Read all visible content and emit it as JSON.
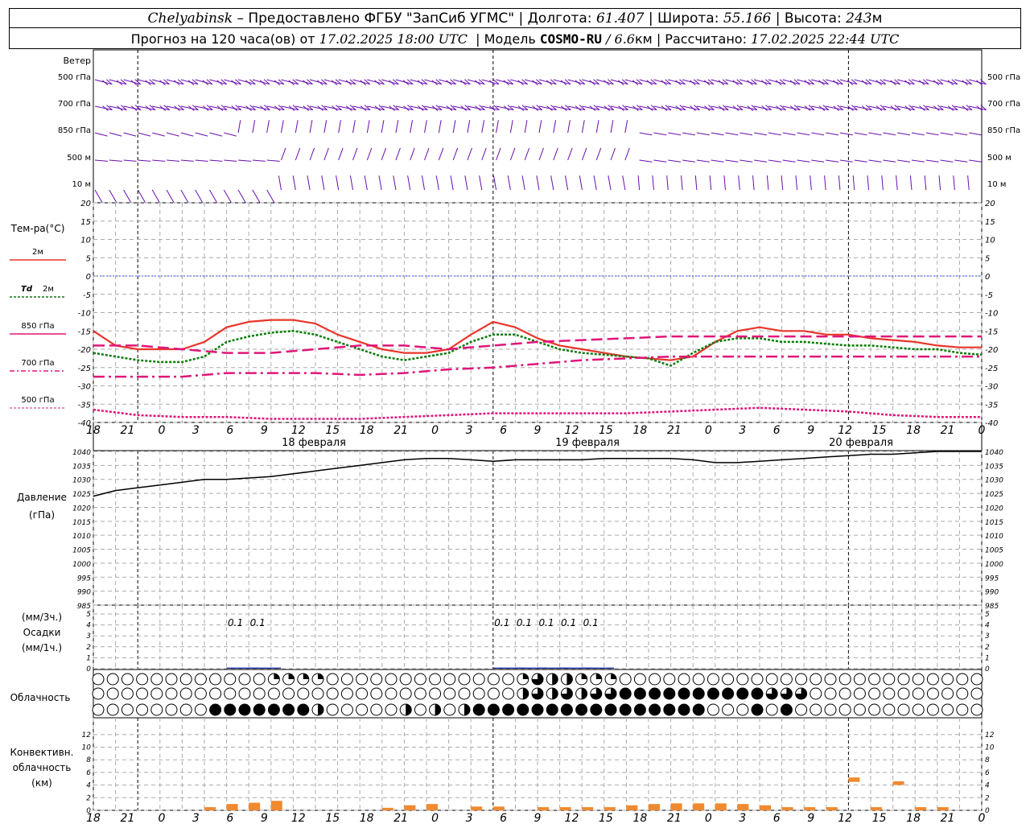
{
  "header": {
    "station": "Chelyabinsk",
    "dash": "–",
    "provider": "Предоставлено ФГБУ \"ЗапСиб УГМС\"",
    "lon_label": "Долгота:",
    "lon_value": "61.407",
    "lat_label": "Широта:",
    "lat_value": "55.166",
    "alt_label": "Высота:",
    "alt_value": "243",
    "alt_unit": "м",
    "forecast_prefix": "Прогноз на 120 часа(ов) от",
    "forecast_time": "17.02.2025 18:00 UTC",
    "model_label": "Модель",
    "model_name": "COSMO-RU",
    "model_res": "/ 6.6",
    "model_res_unit": "км",
    "calc_label": "Рассчитано:",
    "calc_time": "17.02.2025 22:44 UTC"
  },
  "time_axis": {
    "tick_labels": [
      "18",
      "21",
      "0",
      "3",
      "6",
      "9",
      "12",
      "15",
      "18",
      "21",
      "0",
      "3",
      "6",
      "9",
      "12",
      "15",
      "18",
      "21",
      "0",
      "3",
      "6",
      "9",
      "12",
      "15",
      "18",
      "21",
      "0"
    ],
    "day_labels": [
      "18 февраля",
      "19 февраля",
      "20 февраля"
    ]
  },
  "wind": {
    "title": "Ветер",
    "levels": [
      "500 гПа",
      "700 гПа",
      "850 гПа",
      "500 м",
      "10  м"
    ],
    "color": "#6a0dad"
  },
  "temperature": {
    "title": "Тем-ра(°C)",
    "legend_t2m": "2м",
    "legend_td_sym": "Td",
    "legend_td": "2м",
    "legend_850": "850 гПа",
    "legend_700": "700 гПа",
    "legend_500": "500 гПа",
    "ticks": [
      "20",
      "15",
      "10",
      "5",
      "0",
      "-5",
      "-10",
      "-15",
      "-20",
      "-25",
      "-30",
      "-35",
      "-40"
    ],
    "colors": {
      "t2m": "#e8352a",
      "td": "#0a7a0a",
      "t850": "#e0157a",
      "zero": "#3050d0"
    }
  },
  "pressure": {
    "title": "Давление",
    "unit": "(гПа)",
    "ticks": [
      "1040",
      "1035",
      "1030",
      "1025",
      "1020",
      "1015",
      "1010",
      "1005",
      "1000",
      "995",
      "990",
      "985"
    ]
  },
  "precip": {
    "unit_3h": "(мм/3ч.)",
    "title": "Осадки",
    "unit_1h": "(мм/1ч.)",
    "ticks": [
      "5",
      "4",
      "3",
      "2",
      "1",
      "0"
    ],
    "labels": [
      {
        "hour": 18,
        "text": "0.1"
      },
      {
        "hour": 21,
        "text": "0.1"
      },
      {
        "hour": 54,
        "text": "0.1"
      },
      {
        "hour": 57,
        "text": "0.1"
      },
      {
        "hour": 60,
        "text": "0.1"
      },
      {
        "hour": 63,
        "text": "0.1"
      },
      {
        "hour": 66,
        "text": "0.1"
      }
    ]
  },
  "cloudiness": {
    "title": "Облачность"
  },
  "convective": {
    "title1": "Конвективн.",
    "title2": "облачность",
    "unit": "(км)",
    "ticks": [
      "12",
      "10",
      "8",
      "6",
      "4",
      "2",
      "0"
    ],
    "color": "#f08a30"
  },
  "chart_data": [
    {
      "type": "line",
      "title": "Тем-ра(°C)",
      "x_unit": "hours from 17.02.2025 18:00 UTC",
      "ylim": [
        -40,
        20
      ],
      "series": [
        {
          "name": "2м",
          "x": [
            0,
            3,
            6,
            9,
            12,
            15,
            18,
            21,
            24,
            27,
            30,
            33,
            36,
            39,
            42,
            45,
            48,
            51,
            54,
            57,
            60,
            63,
            66,
            69,
            72,
            75,
            78,
            81,
            84,
            87,
            90,
            93,
            96,
            99,
            102,
            105,
            108,
            111,
            114,
            117,
            120
          ],
          "values": [
            -15,
            -19,
            -20,
            -20,
            -20,
            -18,
            -14,
            -12.5,
            -12,
            -12,
            -13,
            -16,
            -18,
            -20,
            -21,
            -21,
            -20,
            -16,
            -12.5,
            -14,
            -17,
            -19,
            -20,
            -21,
            -22,
            -22.5,
            -23,
            -22,
            -18,
            -15,
            -14,
            -15,
            -15,
            -16,
            -16,
            -17,
            -17.5,
            -18,
            -19,
            -19.5,
            -19.5
          ]
        },
        {
          "name": "Td 2м",
          "x": [
            0,
            3,
            6,
            9,
            12,
            15,
            18,
            21,
            24,
            27,
            30,
            33,
            36,
            39,
            42,
            45,
            48,
            51,
            54,
            57,
            60,
            63,
            66,
            69,
            72,
            75,
            78,
            81,
            84,
            87,
            90,
            93,
            96,
            99,
            102,
            105,
            108,
            111,
            114,
            117,
            120
          ],
          "values": [
            -21,
            -22,
            -23,
            -23.5,
            -23.5,
            -22,
            -18,
            -16.5,
            -15.5,
            -15,
            -16,
            -18,
            -20,
            -22,
            -23,
            -22,
            -21,
            -18,
            -16,
            -16,
            -18,
            -20,
            -21,
            -21.5,
            -22,
            -22.5,
            -24.5,
            -21,
            -18,
            -17,
            -17,
            -18,
            -18,
            -18.5,
            -19,
            -19,
            -19.5,
            -20,
            -20,
            -21,
            -21.5
          ]
        },
        {
          "name": "850 гПа",
          "x": [
            0,
            6,
            12,
            18,
            24,
            30,
            36,
            42,
            48,
            54,
            60,
            66,
            72,
            78,
            84,
            90,
            96,
            102,
            108,
            114,
            120
          ],
          "values": [
            -19,
            -19,
            -20,
            -21,
            -21,
            -20,
            -19,
            -19,
            -20,
            -19,
            -18,
            -17.5,
            -17,
            -16.5,
            -16.5,
            -16.5,
            -16.5,
            -16.5,
            -16.5,
            -16.5,
            -16.5
          ]
        },
        {
          "name": "700 гПа",
          "x": [
            0,
            6,
            12,
            18,
            24,
            30,
            36,
            42,
            48,
            54,
            60,
            66,
            72,
            78,
            84,
            90,
            96,
            102,
            108,
            114,
            120
          ],
          "values": [
            -27.5,
            -27.5,
            -27.5,
            -26.5,
            -26.5,
            -26.5,
            -27,
            -26.5,
            -25.5,
            -25,
            -24,
            -23,
            -22.5,
            -22,
            -22,
            -22,
            -22,
            -22,
            -22,
            -22,
            -22
          ]
        },
        {
          "name": "500 гПа",
          "x": [
            0,
            6,
            12,
            18,
            24,
            30,
            36,
            42,
            48,
            54,
            60,
            66,
            72,
            78,
            84,
            90,
            96,
            102,
            108,
            114,
            120
          ],
          "values": [
            -36.5,
            -38,
            -38.5,
            -38.5,
            -39,
            -39,
            -39,
            -38.5,
            -38,
            -37.5,
            -37.5,
            -37.5,
            -37.5,
            -37,
            -36.5,
            -36,
            -36.5,
            -37,
            -38,
            -38.5,
            -38.5
          ]
        }
      ]
    },
    {
      "type": "line",
      "title": "Давление",
      "x_unit": "hours from 17.02.2025 18:00 UTC",
      "ylim": [
        985,
        1040
      ],
      "series": [
        {
          "name": "Давление",
          "x": [
            0,
            3,
            6,
            9,
            12,
            15,
            18,
            21,
            24,
            27,
            30,
            33,
            36,
            39,
            42,
            45,
            48,
            51,
            54,
            57,
            60,
            63,
            66,
            69,
            72,
            75,
            78,
            81,
            84,
            87,
            90,
            93,
            96,
            99,
            102,
            105,
            108,
            111,
            114,
            117,
            120
          ],
          "values": [
            1024,
            1026,
            1027,
            1028,
            1029,
            1030,
            1030,
            1030.5,
            1031,
            1032,
            1033,
            1034,
            1035,
            1036,
            1037,
            1037.5,
            1037.5,
            1037,
            1036.5,
            1037,
            1037,
            1037,
            1037,
            1037.5,
            1037.5,
            1037.5,
            1037.5,
            1037,
            1036,
            1036,
            1036.5,
            1037,
            1037.5,
            1038,
            1038.5,
            1039,
            1039,
            1039.5,
            1040,
            1040,
            1040
          ]
        }
      ]
    },
    {
      "type": "bar",
      "title": "Осадки",
      "x_unit": "hours from 17.02.2025 18:00 UTC",
      "ylim": [
        0,
        5
      ],
      "x": [
        18,
        21,
        54,
        57,
        60,
        63,
        66
      ],
      "values": [
        0.1,
        0.1,
        0.1,
        0.1,
        0.1,
        0.1,
        0.1
      ]
    },
    {
      "type": "bar",
      "title": "Конвективн. облачность",
      "x_unit": "hours from 17.02.2025 18:00 UTC",
      "ylim": [
        0,
        13
      ],
      "series": [
        {
          "x": [
            15,
            18,
            21,
            24,
            39,
            42,
            45,
            51,
            54,
            60,
            63,
            66,
            69,
            72,
            75,
            78,
            81,
            84,
            87,
            90,
            93,
            96,
            99,
            102,
            105,
            108,
            111,
            114
          ],
          "bottom": [
            0,
            0,
            0,
            0,
            0,
            0,
            0,
            0,
            0,
            0,
            0,
            0,
            0,
            0,
            0,
            0,
            0,
            0,
            0,
            0,
            0,
            0,
            0,
            4.5,
            0,
            4,
            0,
            0
          ],
          "top": [
            0.5,
            1,
            1.2,
            1.5,
            0.4,
            0.8,
            1,
            0.6,
            0.6,
            0.5,
            0.5,
            0.5,
            0.5,
            0.8,
            1,
            1.1,
            1.1,
            1.1,
            1,
            0.8,
            0.5,
            0.5,
            0.5,
            5.2,
            0.5,
            4.6,
            0.5,
            0.5
          ]
        }
      ]
    },
    {
      "type": "table",
      "title": "Облачность",
      "rows": [
        {
          "level": "high",
          "x": [
            24,
            26,
            28,
            30
          ],
          "fraction": [
            0.25,
            0.25,
            0.25,
            0.25
          ]
        },
        {
          "level": "high2",
          "x": [
            58,
            59,
            60,
            62,
            64,
            66,
            68,
            70
          ],
          "fraction": [
            0.25,
            0.25,
            0.75,
            0.5,
            0.5,
            0.25,
            0.25,
            0.25
          ]
        },
        {
          "level": "middle",
          "x": [
            58,
            60,
            62,
            64,
            66,
            68,
            70,
            72,
            74,
            76,
            78,
            80,
            82,
            84,
            86,
            88,
            90,
            92,
            94,
            96
          ],
          "fraction": [
            0.5,
            0.75,
            0.5,
            0.75,
            0.5,
            0.75,
            0.75,
            1,
            1,
            1,
            1,
            1,
            1,
            1,
            1,
            1,
            1,
            0.75,
            0.75,
            0.75
          ]
        },
        {
          "level": "low",
          "x": [
            16,
            18,
            20,
            22,
            24,
            26,
            28,
            30,
            33,
            35,
            37,
            42,
            46,
            50,
            52,
            54,
            56,
            58,
            60,
            62,
            64,
            66,
            68,
            70,
            72,
            74,
            76,
            78,
            80,
            82,
            84,
            88,
            90,
            94
          ],
          "fraction": [
            1,
            1,
            1,
            1,
            1,
            1,
            1,
            0.5,
            1,
            1,
            1,
            0.5,
            0.5,
            0.5,
            1,
            1,
            1,
            1,
            1,
            1,
            1,
            1,
            1,
            1,
            1,
            1,
            1,
            1,
            1,
            1,
            0,
            0,
            1,
            1
          ]
        }
      ]
    }
  ]
}
